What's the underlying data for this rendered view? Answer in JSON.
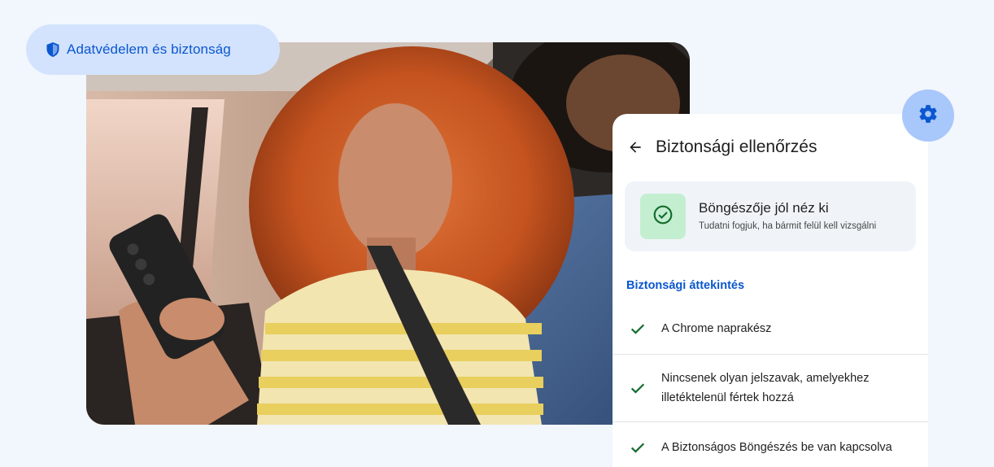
{
  "badge": {
    "label": "Adatvédelem és biztonság",
    "icon": "shield-icon"
  },
  "settings_button": {
    "icon": "gear-icon"
  },
  "panel": {
    "back_icon": "arrow-back-icon",
    "title": "Biztonsági ellenőrzés",
    "status": {
      "icon": "check-circle-icon",
      "title": "Böngészője jól néz ki",
      "subtitle": "Tudatni fogjuk, ha bármit felül kell vizsgálni"
    },
    "section_title": "Biztonsági áttekintés",
    "items": [
      {
        "icon": "check-icon",
        "line1": "A Chrome naprakész",
        "line2": ""
      },
      {
        "icon": "check-icon",
        "line1": "Nincsenek olyan jelszavak, amelyekhez",
        "line2": "illetéktelenül fértek hozzá"
      },
      {
        "icon": "check-icon",
        "line1": "A Biztonságos Böngészés be van kapcsolva",
        "line2": ""
      }
    ]
  },
  "colors": {
    "background": "#f2f6fd",
    "accent_blue": "#0b57d0",
    "badge_bg": "#d3e3fd",
    "gear_bg": "#a8c7fa",
    "success_green": "#146c2e",
    "success_bg": "#c4eed0"
  }
}
